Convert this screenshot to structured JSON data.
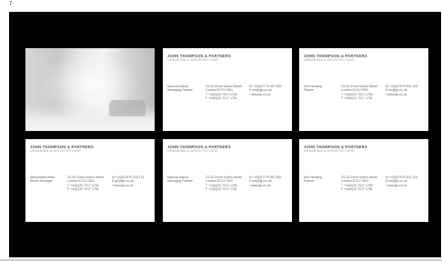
{
  "page": {
    "number": "7"
  },
  "cards": [
    {
      "id": "photo",
      "firm": "",
      "firm_sub": ""
    },
    {
      "id": "card-marcus-top",
      "firm": "JOHN THOMPSON & PARTNERS",
      "firm_sub": "URBANISM & ARCHITECTURE",
      "name": "Marcus Adams",
      "title": "Managing Partner",
      "address": [
        "23-25 Great Sutton Street",
        "London EC1V 0DN",
        "T +44(0)20 7017 1780",
        "F +44(0)20 7017 1781"
      ],
      "contact": [
        "M +44(0)7779 897 882",
        "E ma@jtp.co.uk",
        "I www.jtp.co.uk"
      ]
    },
    {
      "id": "card-kirk",
      "firm": "JOHN THOMPSON & PARTNERS",
      "firm_sub": "URBANISM & ARCHITECTURE",
      "name": "Kirk Hedding",
      "title": "Partner",
      "address": [
        "23-25 Great Sutton Street",
        "London EC1V 0DN",
        "T +44(0)20 7017 1780",
        "F +44(0)20 7017 1781"
      ],
      "contact": [
        "M +44(0)7979 841 201",
        "E kh@jtp.co.uk",
        "I www.jtp.co.uk"
      ]
    },
    {
      "id": "card-bella",
      "firm": "JOHN THOMPSON & PARTNERS",
      "firm_sub": "URBANISM & ARCHITECTURE",
      "name": "Stewardess Bella",
      "title": "Studio Manager",
      "address": [
        "23-25 Great Sutton Street",
        "London EC1V 0DN",
        "T +44(0)20 7017 1780",
        "F +44(0)20 7017 1781"
      ],
      "contact": [
        "M +44(0)7870 215 132",
        "E gb@jtp.co.uk",
        "I www.jtp.co.uk"
      ]
    },
    {
      "id": "card-marcus-bottom",
      "firm": "JOHN THOMPSON & PARTNERS",
      "firm_sub": "URBANISM & ARCHITECTURE",
      "name": "Marcus Adams",
      "title": "Managing Partner",
      "address": [
        "23-25 Great Sutton Street",
        "London EC1V 0DN",
        "T +44(0)20 7017 1780",
        "F +44(0)20 7017 1781"
      ],
      "contact": [
        "M +44(0)7779 897 882",
        "E ma@jtp.co.uk",
        "I www.jtp.co.uk"
      ]
    },
    {
      "id": "card-kirk-bottom",
      "firm": "JOHN THOMPSON & PARTNERS",
      "firm_sub": "URBANISM & ARCHITECTURE",
      "name": "Kirk Hedding",
      "title": "Partner",
      "address": [
        "23-25 Great Sutton Street",
        "London EC1V 0DN",
        "T +44(0)20 7017 1780",
        "F +44(0)20 7017 1781"
      ],
      "contact": [
        "M +44(0)7979 841 201",
        "E kh@jtp.co.uk",
        "I www.jtp.co.uk"
      ]
    }
  ]
}
